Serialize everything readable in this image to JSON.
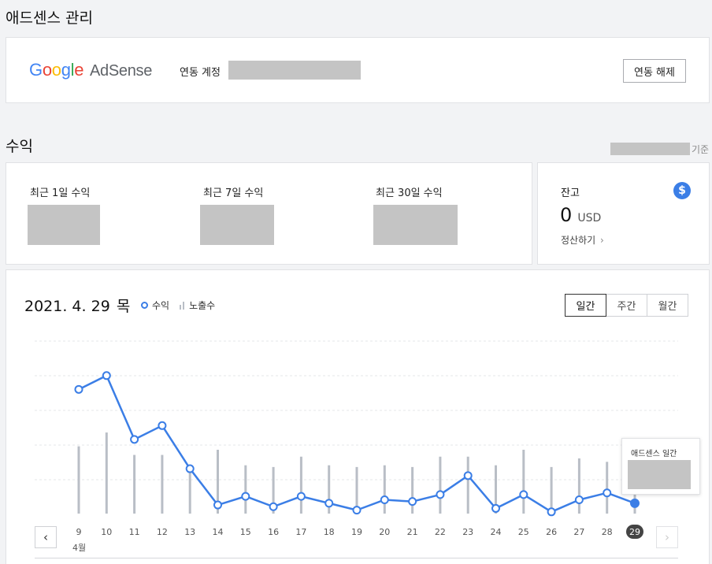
{
  "page": {
    "title": "애드센스 관리"
  },
  "adsense": {
    "logo": {
      "google": "Google",
      "product": "AdSense"
    },
    "linked_account_label": "연동 계정",
    "unlink_button": "연동 해제"
  },
  "revenue": {
    "title": "수익",
    "as_of_suffix": "기준",
    "stats": [
      {
        "label": "최근 1일 수익"
      },
      {
        "label": "최근 7일 수익"
      },
      {
        "label": "최근 30일 수익"
      }
    ]
  },
  "balance": {
    "label": "잔고",
    "amount": "0",
    "unit": "USD",
    "settle_link": "정산하기",
    "icon": "dollar-icon"
  },
  "chart": {
    "date_label": "2021. 4. 29",
    "weekday": "목",
    "legend": {
      "revenue": "수익",
      "impressions": "노출수"
    },
    "period_tabs": [
      "일간",
      "주간",
      "월간"
    ],
    "active_tab": 0,
    "month_label": "4월",
    "tooltip_title": "애드센스 일간",
    "colors": {
      "revenue_line": "#3b7ee6",
      "impression_bar": "#b9bec6"
    }
  },
  "chart_data": {
    "type": "line",
    "categories": [
      "9",
      "10",
      "11",
      "12",
      "13",
      "14",
      "15",
      "16",
      "17",
      "18",
      "19",
      "20",
      "21",
      "22",
      "23",
      "24",
      "25",
      "26",
      "27",
      "28",
      "29"
    ],
    "series": [
      {
        "name": "수익",
        "values": [
          0.72,
          0.8,
          0.43,
          0.51,
          0.26,
          0.05,
          0.1,
          0.04,
          0.1,
          0.06,
          0.02,
          0.08,
          0.07,
          0.11,
          0.22,
          0.03,
          0.11,
          0.01,
          0.08,
          0.12,
          0.06
        ]
      },
      {
        "name": "노출수",
        "values": [
          0.39,
          0.47,
          0.34,
          0.34,
          0.25,
          0.37,
          0.28,
          0.27,
          0.33,
          0.28,
          0.27,
          0.28,
          0.27,
          0.33,
          0.33,
          0.28,
          0.37,
          0.27,
          0.32,
          0.3,
          0.24
        ]
      }
    ],
    "ylim": [
      0,
      1
    ],
    "selected_category": "29",
    "grid": true
  }
}
